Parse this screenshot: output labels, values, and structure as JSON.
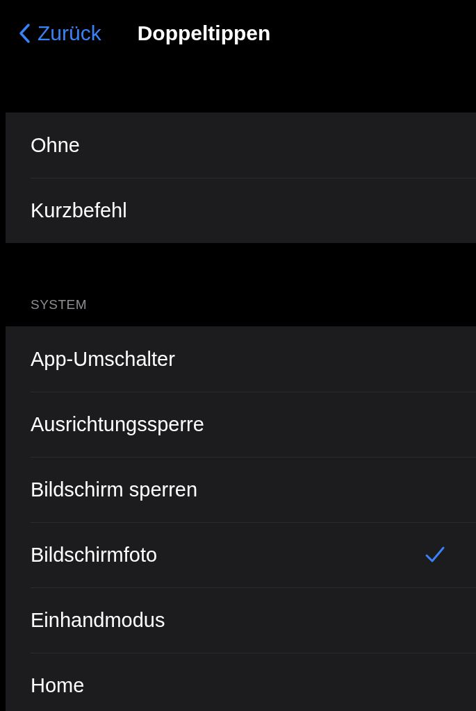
{
  "nav_bar": {
    "back_label": "Zurück",
    "title": "Doppeltippen"
  },
  "sections": [
    {
      "items": [
        {
          "label": "Ohne",
          "selected": false
        },
        {
          "label": "Kurzbefehl",
          "selected": false
        }
      ]
    },
    {
      "header": "SYSTEM",
      "items": [
        {
          "label": "App-Umschalter",
          "selected": false
        },
        {
          "label": "Ausrichtungssperre",
          "selected": false
        },
        {
          "label": "Bildschirm sperren",
          "selected": false
        },
        {
          "label": "Bildschirmfoto",
          "selected": true
        },
        {
          "label": "Einhandmodus",
          "selected": false
        },
        {
          "label": "Home",
          "selected": false
        }
      ]
    }
  ]
}
